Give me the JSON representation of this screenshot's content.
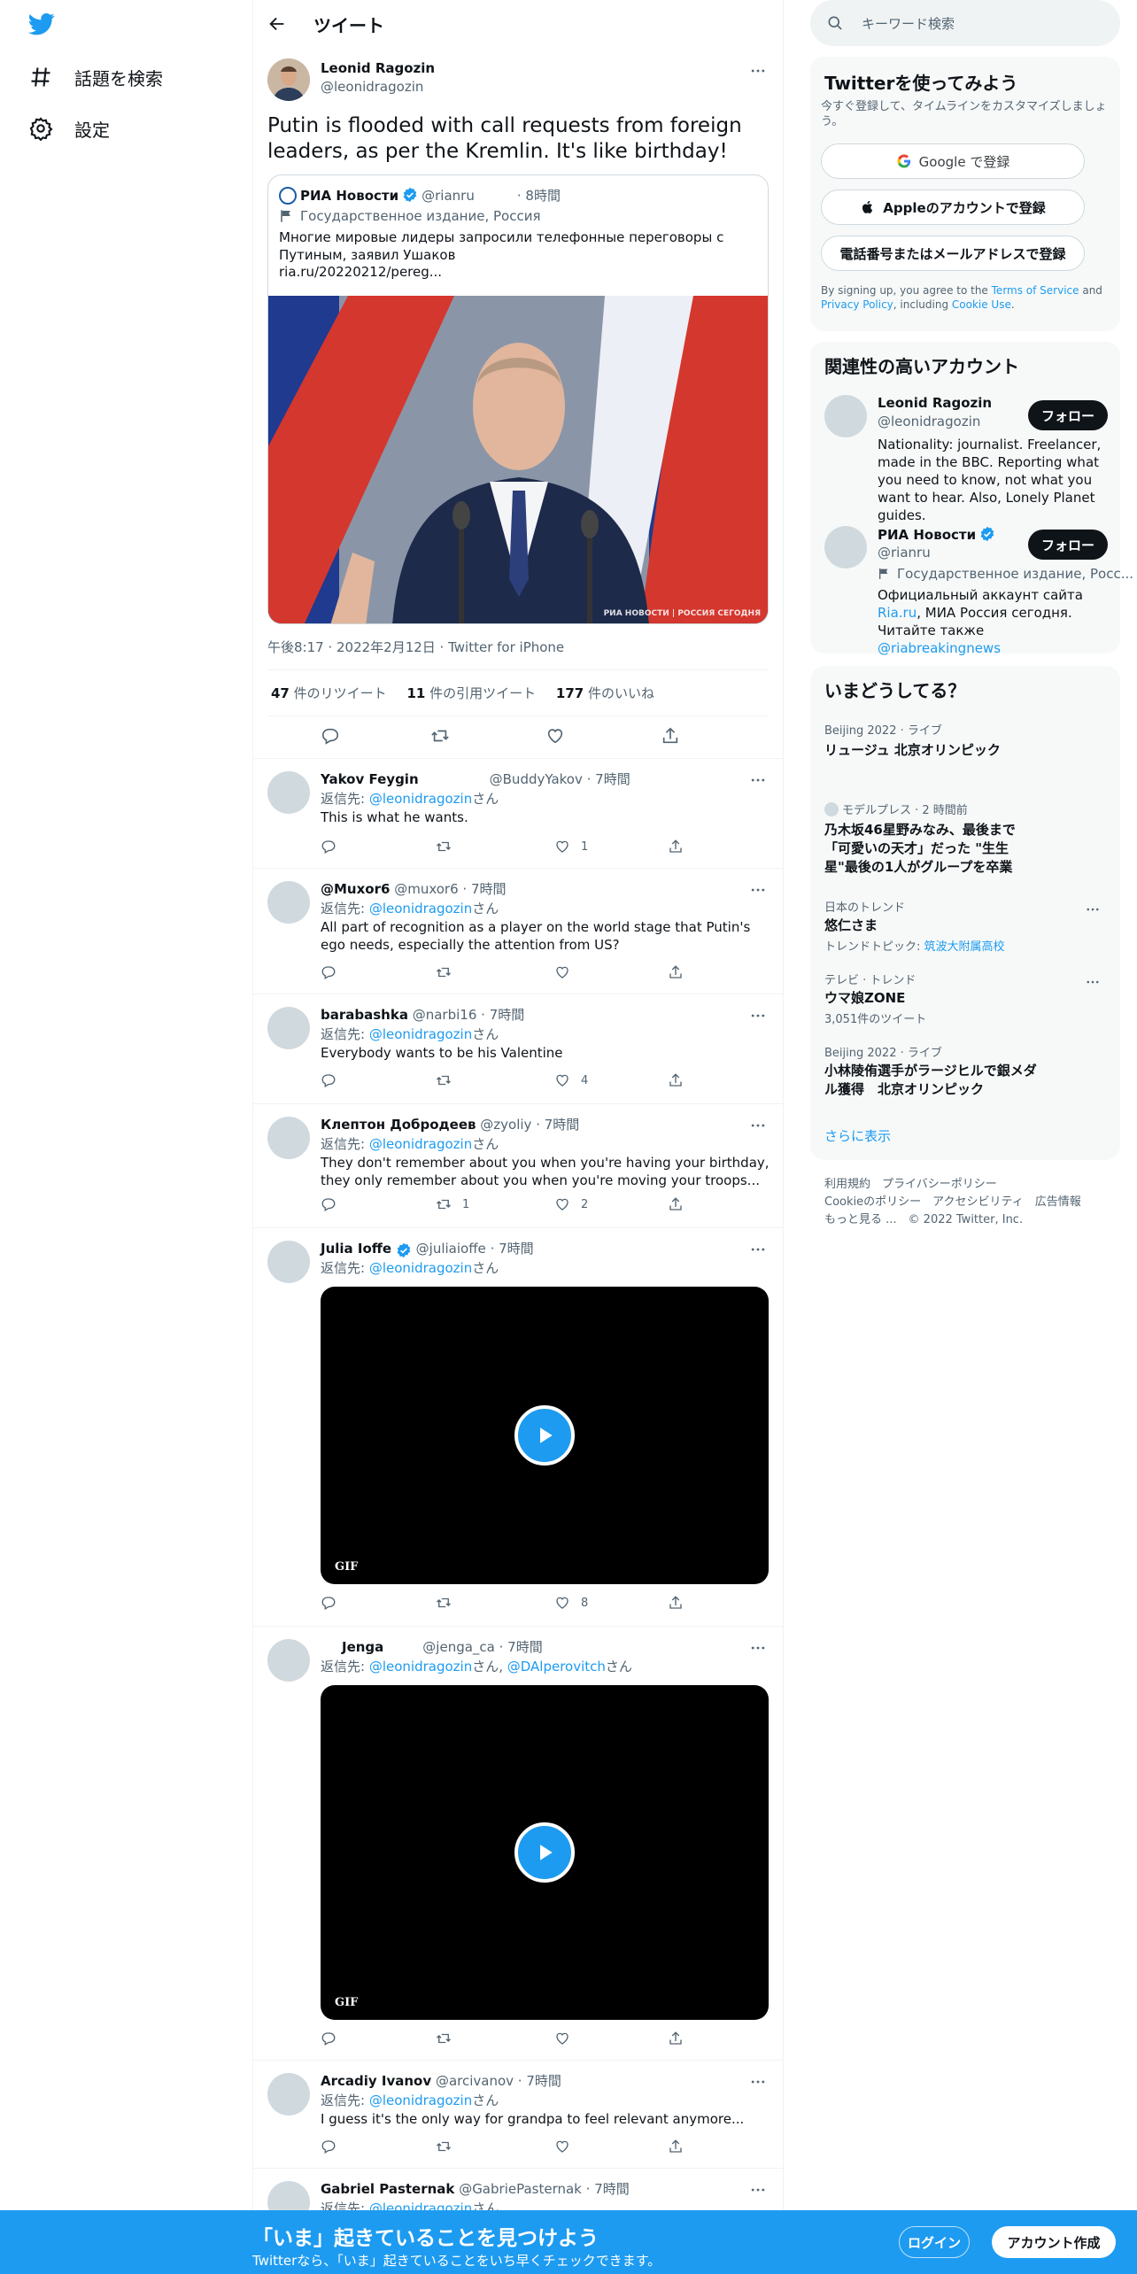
{
  "nav": {
    "explore_label": "話題を検索",
    "settings_label": "設定"
  },
  "header": {
    "title": "ツイート"
  },
  "tweet": {
    "author_name": "Leonid Ragozin",
    "author_handle": "@leonidragozin",
    "text": "Putin is flooded with call requests from foreign leaders, as per the Kremlin. It's like birthday!",
    "quote": {
      "name": "РИА Новости",
      "handle": "@rianru",
      "time": "· 8時間",
      "label": "Государственное издание, Россия",
      "text": "Многие мировые лидеры запросили телефонные переговоры с Путиным, заявил Ушаков",
      "link": "ria.ru/20220212/pereg...",
      "watermark": "РИА НОВОСТИ | РОССИЯ СЕГОДНЯ"
    },
    "timestamp": "午後8:17 · 2022年2月12日 · Twitter for iPhone",
    "stats": {
      "retweets_num": "47",
      "retweets_label": "件のリツイート",
      "quotes_num": "11",
      "quotes_label": "件の引用ツイート",
      "likes_num": "177",
      "likes_label": "件のいいね"
    }
  },
  "replies": [
    {
      "name": "Yakov Feygin",
      "handle": "@BuddyYakov",
      "time": "· 7時間",
      "reply_prefix": "返信先: ",
      "reply_to": "@leonidragozin",
      "reply_suffix": "さん",
      "text": "This is what he wants.",
      "retweets": "",
      "likes": "1"
    },
    {
      "name": "@Muxor6",
      "handle": "@muxor6",
      "time": "· 7時間",
      "reply_prefix": "返信先: ",
      "reply_to": "@leonidragozin",
      "reply_suffix": "さん",
      "text": "All part of recognition as a player on the world stage that Putin's ego needs, especially the attention from US?",
      "retweets": "",
      "likes": ""
    },
    {
      "name": "barabashka",
      "handle": "@narbi16",
      "time": "· 7時間",
      "reply_prefix": "返信先: ",
      "reply_to": "@leonidragozin",
      "reply_suffix": "さん",
      "text": "Everybody wants to be his Valentine",
      "retweets": "",
      "likes": "4"
    },
    {
      "name": "Клептон Добродеев",
      "handle": "@zyoliy",
      "time": "· 7時間",
      "reply_prefix": "返信先: ",
      "reply_to": "@leonidragozin",
      "reply_suffix": "さん",
      "text": "They don't remember about you when you're having your birthday, they only remember about you when you're moving your troops...",
      "retweets": "1",
      "likes": "2"
    },
    {
      "name": "Julia Ioffe",
      "handle": "@juliaioffe",
      "time": "· 7時間",
      "reply_prefix": "返信先: ",
      "reply_to": "@leonidragozin",
      "reply_suffix": "さん",
      "text": "",
      "media": "GIF",
      "retweets": "",
      "likes": "8"
    },
    {
      "name": "Jenga",
      "handle": "@jenga_ca",
      "time": "· 7時間",
      "reply_prefix": "返信先: ",
      "reply_to": "@leonidragozin",
      "reply_mid": "さん, ",
      "reply_to2": "@DAlperovitch",
      "reply_suffix": "さん",
      "text": "",
      "media": "GIF",
      "retweets": "",
      "likes": ""
    },
    {
      "name": "Arcadiy Ivanov",
      "handle": "@arcivanov",
      "time": "· 7時間",
      "reply_prefix": "返信先: ",
      "reply_to": "@leonidragozin",
      "reply_suffix": "さん",
      "text": "I guess it's the only way for grandpa to feel relevant anymore...",
      "retweets": "",
      "likes": ""
    },
    {
      "name": "Gabriel Pasternak",
      "handle": "@GabriePasternak",
      "time": "· 7時間",
      "reply_prefix": "返信先: ",
      "reply_to": "@leonidragozin",
      "reply_suffix": "さん"
    }
  ],
  "search": {
    "placeholder": "キーワード検索"
  },
  "signup": {
    "title": "Twitterを使ってみよう",
    "subtitle": "今すぐ登録して、タイムラインをカスタマイズしましょう。",
    "google": "Google で登録",
    "apple": "Appleのアカウントで登録",
    "phone": "電話番号またはメールアドレスで登録",
    "legal_1": "By signing up, you agree to the ",
    "terms": "Terms of Service",
    "legal_2": " and ",
    "privacy": "Privacy Policy",
    "legal_3": ", including ",
    "cookie": "Cookie Use",
    "legal_4": "."
  },
  "relevant": {
    "title": "関連性の高いアカウント",
    "follow_label": "フォロー",
    "accounts": [
      {
        "name": "Leonid Ragozin",
        "handle": "@leonidragozin",
        "bio": "Nationality: journalist. Freelancer, made in the BBC. Reporting what you need to know, not what you want to hear. Also, Lonely Planet guides."
      },
      {
        "name": "РИА Новости",
        "handle": "@rianru",
        "label": "Государственное издание, Росс...",
        "bio_1": "Официальный аккаунт сайта ",
        "bio_link": "Ria.ru",
        "bio_2": ", МИА Россия сегодня. Читайте также ",
        "bio_link2": "@riabreakingnews"
      }
    ]
  },
  "trends": {
    "title": "いまどうしてる？",
    "items": [
      {
        "cat": "Beijing 2022 · ライブ",
        "name": "リュージュ 北京オリンピック"
      },
      {
        "cat": "モデルプレス · 2 時間前",
        "name": "乃木坂46星野みなみ、最後まで「可愛いの天才」だった \"生生星\"最後の1人がグループを卒業"
      },
      {
        "cat": "日本のトレンド",
        "name": "悠仁さま",
        "meta_1": "トレンドトピック: ",
        "meta_link": "筑波大附属高校"
      },
      {
        "cat": "テレビ · トレンド",
        "name": "ウマ娘ZONE",
        "meta": "3,051件のツイート"
      },
      {
        "cat": "Beijing 2022 · ライブ",
        "name": "小林陵侑選手がラージヒルで銀メダル獲得　北京オリンピック"
      }
    ],
    "show_more": "さらに表示"
  },
  "footer": {
    "l1": "利用規約",
    "l2": "プライバシーポリシー",
    "l3": "Cookieのポリシー",
    "l4": "アクセシビリティ",
    "l5": "広告情報",
    "l6": "もっと見る ...",
    "copyright": "© 2022 Twitter, Inc."
  },
  "bottombar": {
    "title": "「いま」起きていることを見つけよう",
    "subtitle": "Twitterなら、「いま」起きていることをいち早くチェックできます。",
    "login": "ログイン",
    "signup": "アカウント作成"
  },
  "colors": {
    "accent": "#1d9bf0",
    "text": "#0f1419",
    "muted": "#536471"
  }
}
